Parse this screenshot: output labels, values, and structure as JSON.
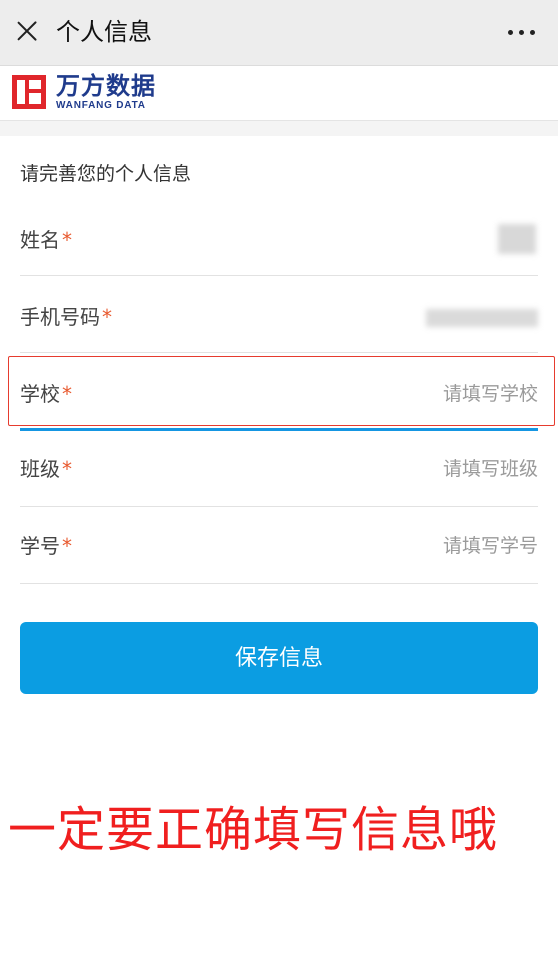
{
  "topbar": {
    "title": "个人信息"
  },
  "logo": {
    "cn": "万方数据",
    "en": "WANFANG DATA",
    "brand_color": "#1f3b8c",
    "accent_color": "#e0262b"
  },
  "form": {
    "section_title": "请完善您的个人信息",
    "required_mark": "*",
    "fields": [
      {
        "label": "姓名",
        "value": "",
        "placeholder": ""
      },
      {
        "label": "手机号码",
        "value": "",
        "placeholder": ""
      },
      {
        "label": "学校",
        "value": "",
        "placeholder": "请填写学校"
      },
      {
        "label": "班级",
        "value": "",
        "placeholder": "请填写班级"
      },
      {
        "label": "学号",
        "value": "",
        "placeholder": "请填写学号"
      }
    ]
  },
  "save_button": {
    "label": "保存信息",
    "color": "#0b9de2"
  },
  "annotation": {
    "text": "一定要正确填写信息哦",
    "color": "#f01f1f"
  }
}
